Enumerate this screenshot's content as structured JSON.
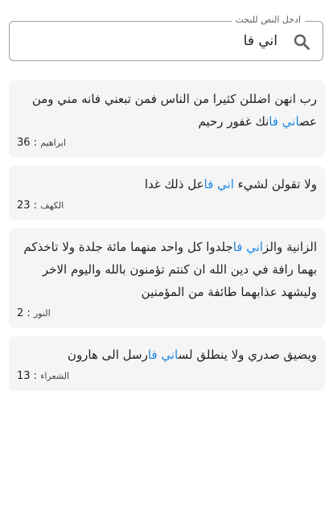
{
  "search": {
    "label": "ادخل النص للبحث",
    "value": "اني فا"
  },
  "results": [
    {
      "segments": [
        {
          "text": "رب انهن اضللن كثيرا من الناس فمن تبعني فانه مني ومن عص",
          "hl": false
        },
        {
          "text": "اني فا",
          "hl": true
        },
        {
          "text": "نك غفور رحيم",
          "hl": false
        }
      ],
      "sura": "ابراهيم",
      "verse": "36"
    },
    {
      "segments": [
        {
          "text": "ولا تقولن لشيء ",
          "hl": false
        },
        {
          "text": "اني فا",
          "hl": true
        },
        {
          "text": "عل ذلك غدا",
          "hl": false
        }
      ],
      "sura": "الكهف",
      "verse": "23"
    },
    {
      "segments": [
        {
          "text": "الزانية والز",
          "hl": false
        },
        {
          "text": "اني فا",
          "hl": true
        },
        {
          "text": "جلدوا كل واحد منهما مائة جلدة ولا تاخذكم بهما رافة في دين الله ان كنتم تؤمنون بالله واليوم الاخر وليشهد عذابهما طائفة من المؤمنين",
          "hl": false
        }
      ],
      "sura": "النور",
      "verse": "2"
    },
    {
      "segments": [
        {
          "text": "ويضيق صدري ولا ينطلق لس",
          "hl": false
        },
        {
          "text": "اني فا",
          "hl": true
        },
        {
          "text": "رسل الى هارون",
          "hl": false
        }
      ],
      "sura": "الشعراء",
      "verse": "13"
    }
  ],
  "colors": {
    "highlight": "#1e88e5",
    "card_background": "#f5f5f5",
    "border": "#9e9e9e"
  },
  "icons": {
    "search": "search-icon"
  }
}
